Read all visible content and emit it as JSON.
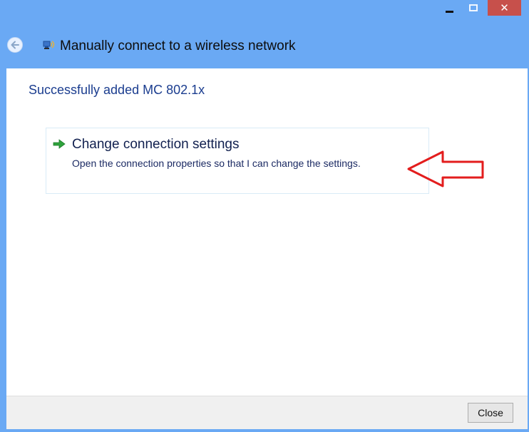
{
  "titlebar": {
    "close_glyph": "✕",
    "accent_color": "#6aa9f4",
    "close_color": "#c7504b"
  },
  "header": {
    "title": "Manually connect to a wireless network",
    "back_icon": "back-arrow-icon",
    "network_icon": "wireless-network-icon"
  },
  "content": {
    "heading": "Successfully added MC 802.1x",
    "link": {
      "title": "Change connection settings",
      "description": "Open the connection properties so that I can change the settings.",
      "icon": "green-arrow-icon"
    },
    "annotation_icon": "red-arrow-icon"
  },
  "footer": {
    "close_label": "Close"
  }
}
